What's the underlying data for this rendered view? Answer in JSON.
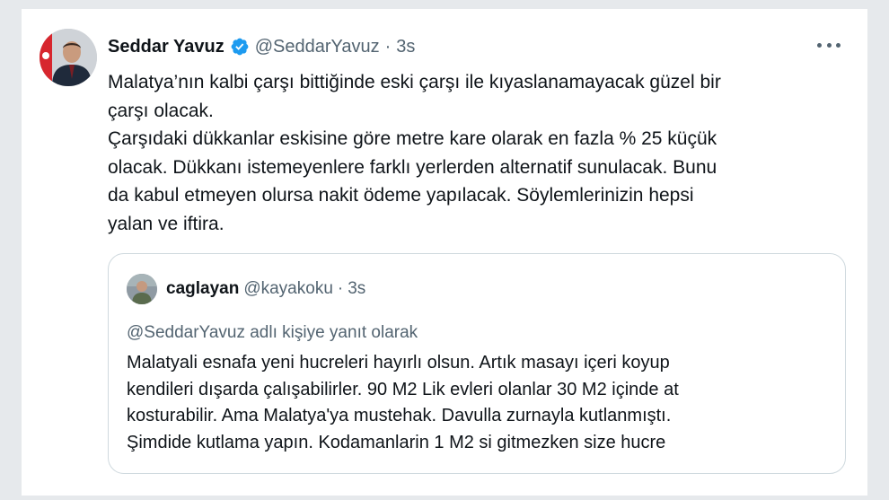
{
  "tweet": {
    "author_name": "Seddar Yavuz",
    "handle": "@SeddarYavuz",
    "separator": "·",
    "time": "3s",
    "text_lines": [
      "Malatya’nın kalbi çarşı bittiğinde eski çarşı ile kıyaslanamayacak güzel bir",
      "çarşı olacak.",
      "Çarşıdaki dükkanlar eskisine göre metre kare olarak en fazla % 25 küçük",
      "olacak. Dükkanı istemeyenlere farklı yerlerden alternatif sunulacak. Bunu",
      "da kabul etmeyen olursa nakit ödeme yapılacak. Söylemlerinizin hepsi",
      "yalan ve iftira."
    ],
    "verified_icon": "verified-badge-icon",
    "more_icon": "more-horizontal-icon"
  },
  "quote": {
    "author_name": "caglayan",
    "handle": "@kayakoku",
    "separator": "·",
    "time": "3s",
    "reply_context": "@SeddarYavuz adlı kişiye yanıt olarak",
    "text_lines": [
      "Malatyali esnafa yeni hucreleri hayırlı olsun. Artık masayı içeri koyup",
      "kendileri dışarda çalışabilirler. 90 M2 Lik evleri olanlar 30 M2 içinde at",
      "kosturabilir. Ama Malatya'ya mustehak. Davulla zurnayla kutlanmıştı.",
      "Şimdide kutlama yapın. Kodamanlarin 1 M2 si gitmezken size hucre"
    ]
  },
  "colors": {
    "verified": "#1d9bf0",
    "text": "#0f1419",
    "secondary": "#536471",
    "border": "#cfd9de"
  }
}
